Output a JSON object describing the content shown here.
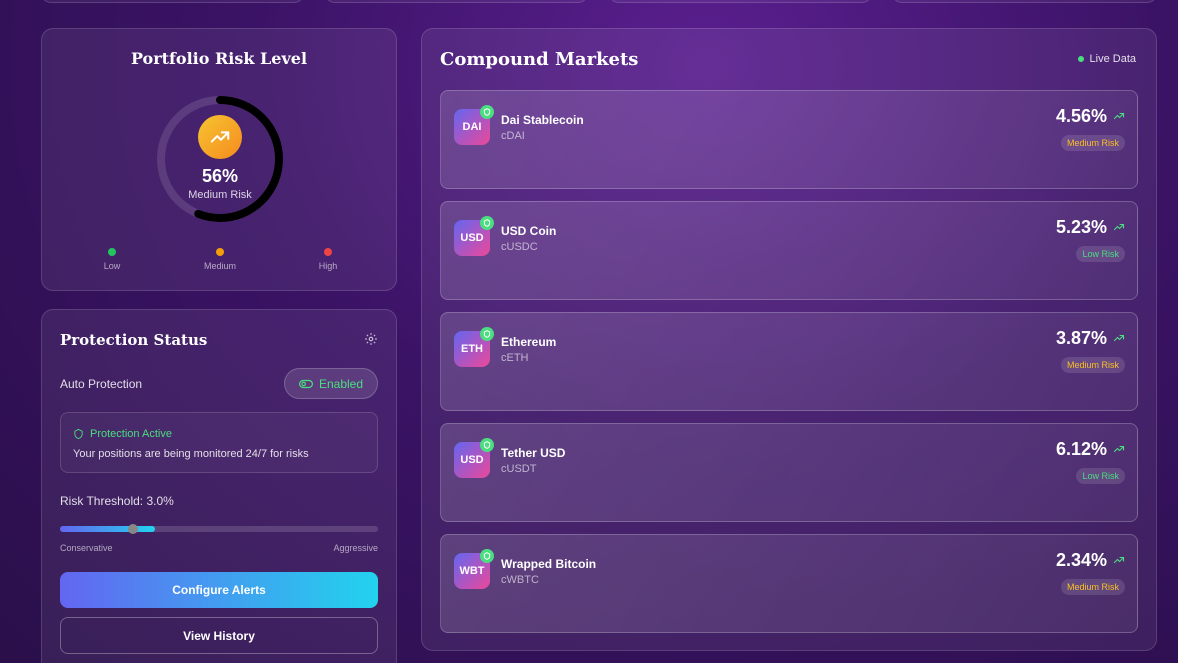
{
  "risk": {
    "title": "Portfolio Risk Level",
    "percent": "56%",
    "percent_value": 56,
    "level_label": "Medium Risk",
    "icon": "trending-up-icon",
    "legend": [
      {
        "label": "Low",
        "color": "#22c55e"
      },
      {
        "label": "Medium",
        "color": "#f59e0b"
      },
      {
        "label": "High",
        "color": "#ef4444"
      }
    ]
  },
  "protection": {
    "title": "Protection Status",
    "auto_label": "Auto Protection",
    "toggle_label": "Enabled",
    "status_title": "Protection Active",
    "status_desc": "Your positions are being monitored 24/7 for risks",
    "threshold_label": "Risk Threshold: 3.0%",
    "threshold_fraction": 0.23,
    "fill_fraction": 0.3,
    "range_min": "Conservative",
    "range_max": "Aggressive",
    "configure_label": "Configure Alerts",
    "history_label": "View History"
  },
  "markets": {
    "title": "Compound Markets",
    "live_label": "Live Data",
    "items": [
      {
        "icon": "DAI",
        "name": "Dai Stablecoin",
        "symbol": "cDAI",
        "apy": "4.56%",
        "risk": "Medium Risk",
        "risk_color": "#fbbf24"
      },
      {
        "icon": "USD",
        "name": "USD Coin",
        "symbol": "cUSDC",
        "apy": "5.23%",
        "risk": "Low Risk",
        "risk_color": "#4ade80"
      },
      {
        "icon": "ETH",
        "name": "Ethereum",
        "symbol": "cETH",
        "apy": "3.87%",
        "risk": "Medium Risk",
        "risk_color": "#fbbf24"
      },
      {
        "icon": "USD",
        "name": "Tether USD",
        "symbol": "cUSDT",
        "apy": "6.12%",
        "risk": "Low Risk",
        "risk_color": "#4ade80"
      },
      {
        "icon": "WBT",
        "name": "Wrapped Bitcoin",
        "symbol": "cWBTC",
        "apy": "2.34%",
        "risk": "Medium Risk",
        "risk_color": "#fbbf24"
      }
    ]
  }
}
